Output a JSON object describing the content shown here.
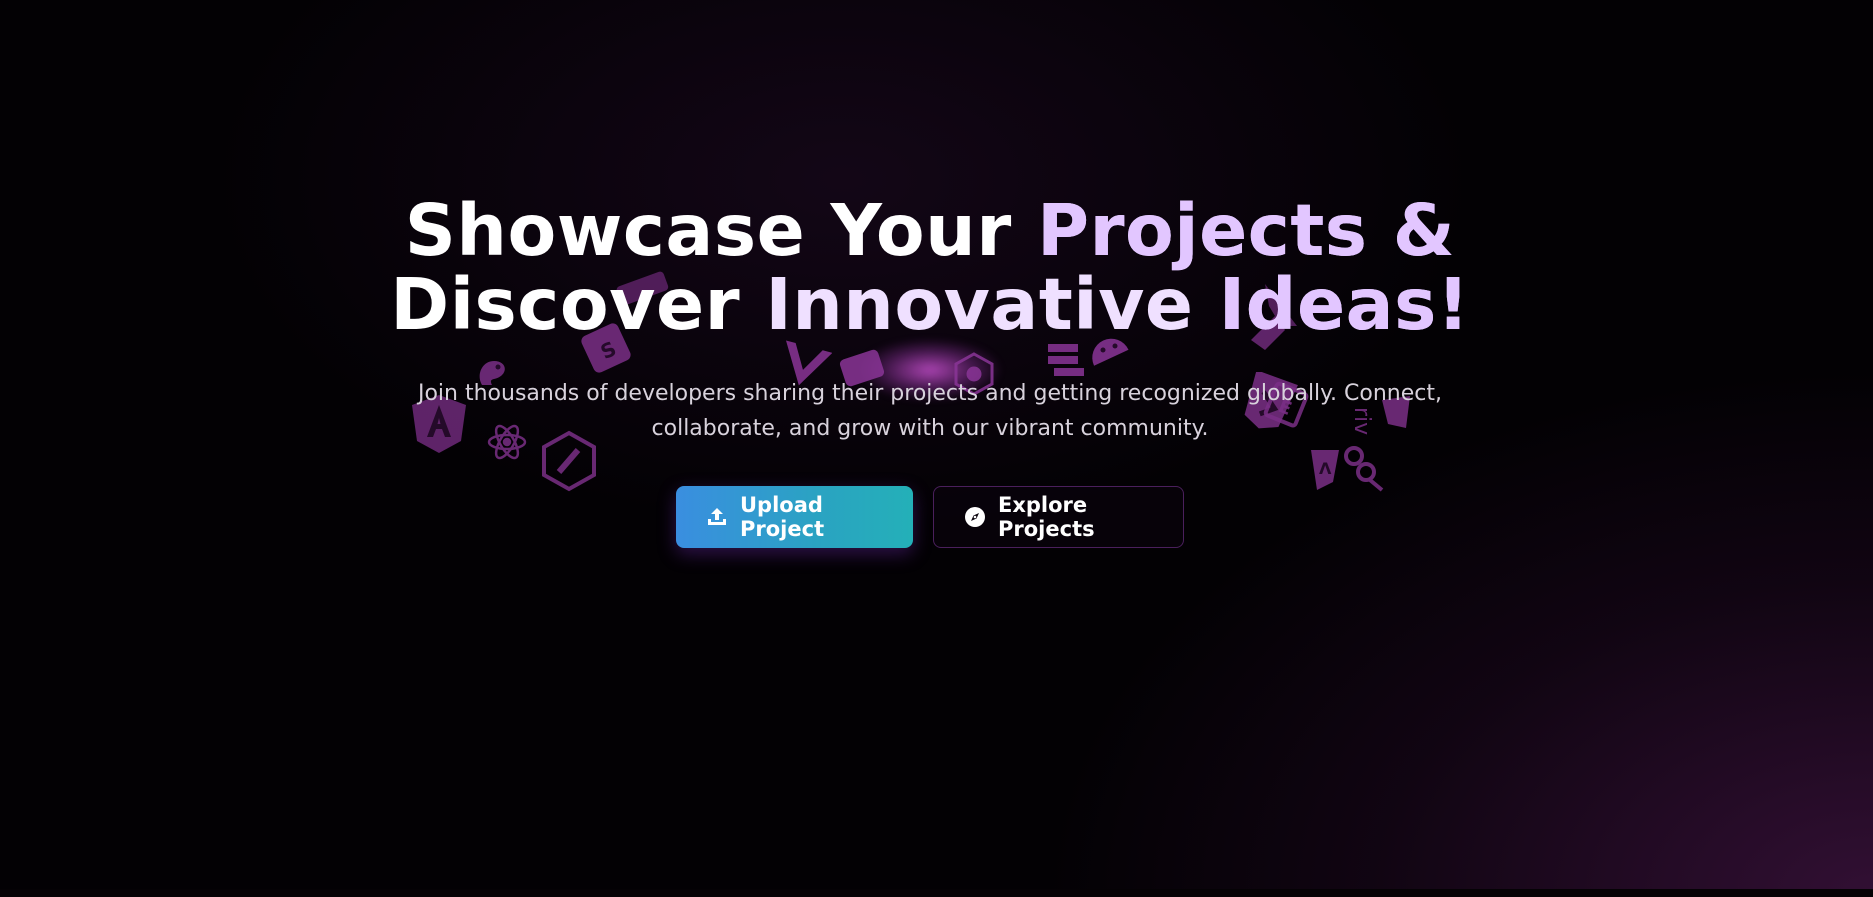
{
  "hero": {
    "title_line1_part1": "Showcase Your ",
    "title_line1_part2": "Projects &",
    "title_line2_part1": "Discover ",
    "title_line2_part2": "Innovative ",
    "title_line2_part3": "Ideas!",
    "subtitle": "Join thousands of developers sharing their projects and getting recognized globally. Connect, collaborate, and grow with our vibrant community."
  },
  "actions": {
    "upload_label": "Upload Project",
    "upload_icon": "upload-icon",
    "explore_label": "Explore Projects",
    "explore_icon": "compass-icon"
  },
  "colors": {
    "background": "#030104",
    "title": "#ffffff",
    "title_accent": "#e2c6ff",
    "subtitle": "#d8d2dc",
    "primary_button_gradient_start": "#3a8ee0",
    "primary_button_gradient_end": "#24b0b8",
    "secondary_button_border": "#4a1f5c",
    "floating_icons": "#7a2f86"
  },
  "floating_icons": [
    "angular-icon",
    "react-icon",
    "python-icon",
    "java-icon",
    "kotlin-icon",
    "sass-icon",
    "android-icon",
    "flutter-icon",
    "vue-icon",
    "kubernetes-icon",
    "docker-icon",
    "html5-icon",
    "css3-icon",
    "graphql-icon",
    "rust-icon"
  ]
}
